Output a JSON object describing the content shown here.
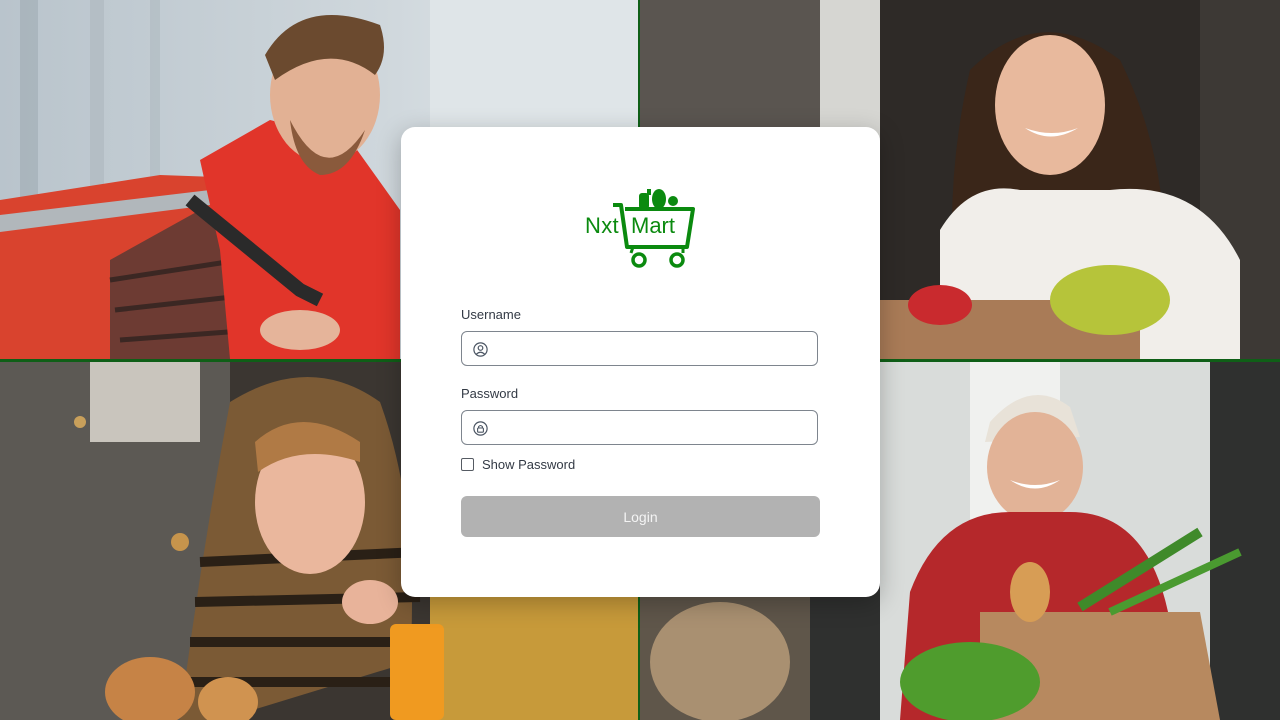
{
  "brand": {
    "logo_left": "Nxt",
    "logo_right": "Mart",
    "primary_color": "#0b8a0f"
  },
  "login": {
    "username_label": "Username",
    "username_value": "",
    "username_icon": "user-icon",
    "password_label": "Password",
    "password_value": "",
    "password_icon": "lock-icon",
    "show_password_label": "Show Password",
    "show_password_checked": false,
    "login_button_label": "Login",
    "login_button_color": "#b2b2b2"
  }
}
